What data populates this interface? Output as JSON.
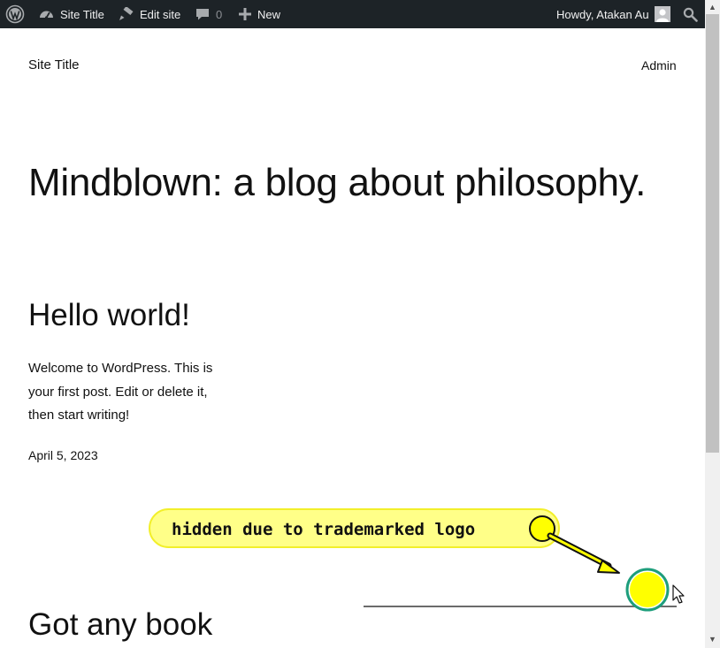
{
  "admin_bar": {
    "site_title": "Site Title",
    "edit_site": "Edit site",
    "comments_count": "0",
    "new_label": "New",
    "greeting": "Howdy, Atakan Au"
  },
  "header": {
    "site_title": "Site Title",
    "nav_admin": "Admin"
  },
  "main": {
    "headline": "Mindblown: a blog about philosophy.",
    "posts": [
      {
        "title": "Hello world!",
        "excerpt": "Welcome to WordPress. This is your first post. Edit or delete it, then start writing!",
        "date": "April 5, 2023"
      },
      {
        "title": "Got any book"
      }
    ]
  },
  "annotation": {
    "label": "hidden due to trademarked logo"
  },
  "icons": [
    "wordpress-logo-icon",
    "dashboard-icon",
    "edit-brush-icon",
    "comment-icon",
    "plus-icon",
    "user-avatar-icon",
    "search-icon",
    "cursor-icon"
  ],
  "colors": {
    "admin_bar_bg": "#1d2327",
    "annotation_yellow": "#ffff00",
    "annotation_ring": "#1e9e7c"
  }
}
